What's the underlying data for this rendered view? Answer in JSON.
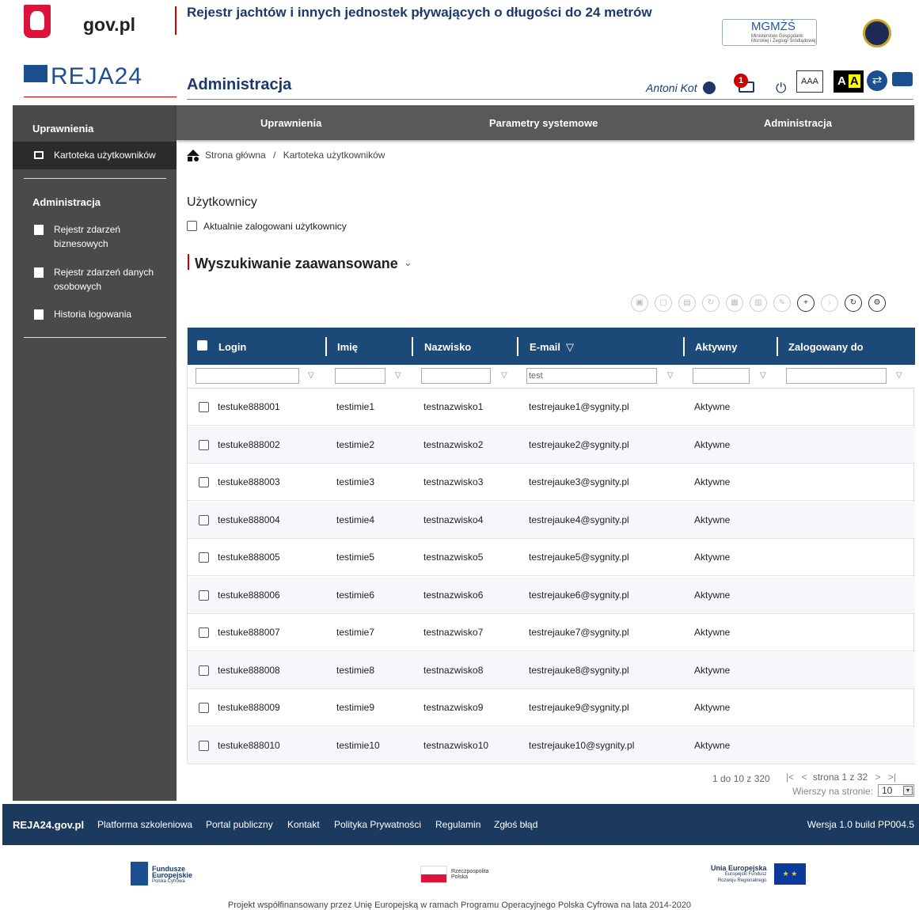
{
  "header": {
    "gov": "gov.pl",
    "registry_title": "Rejestr jachtów i innych jednostek pływających o długości do 24 metrów",
    "mgm_main": "MGMŻŚ",
    "mgm_sub": "Ministerstwo Gospodarki Morskiej i Żeglugi Śródlądowej",
    "app_logo": "REJA24",
    "page_title": "Administracja",
    "user_name": "Antoni Kot",
    "mail_badge": "1",
    "font_size_label": "AAA",
    "contrast_a1": "A",
    "contrast_a2": "A"
  },
  "sidebar": {
    "section1": "Uprawnienia",
    "item_users": "Kartoteka użytkowników",
    "section2": "Administracja",
    "item_business": "Rejestr zdarzeń biznesowych",
    "item_personal": "Rejestr zdarzeń danych osobowych",
    "item_login": "Historia logowania"
  },
  "topnav": {
    "tab1": "Uprawnienia",
    "tab2": "Parametry systemowe",
    "tab3": "Administracja"
  },
  "breadcrumb": {
    "home": "Strona główna",
    "sep": "/",
    "current": "Kartoteka użytkowników"
  },
  "main": {
    "heading": "Użytkownicy",
    "logged_checkbox": "Aktualnie zalogowani użytkownicy",
    "advanced": "Wyszukiwanie zaawansowane"
  },
  "grid": {
    "columns": [
      "Login",
      "Imię",
      "Nazwisko",
      "E-mail",
      "Aktywny",
      "Zalogowany do"
    ],
    "filter_email": "test",
    "rows": [
      [
        "testuke888001",
        "testimie1",
        "testnazwisko1",
        "testrejauke1@sygnity.pl",
        "Aktywne"
      ],
      [
        "testuke888002",
        "testimie2",
        "testnazwisko2",
        "testrejauke2@sygnity.pl",
        "Aktywne"
      ],
      [
        "testuke888003",
        "testimie3",
        "testnazwisko3",
        "testrejauke3@sygnity.pl",
        "Aktywne"
      ],
      [
        "testuke888004",
        "testimie4",
        "testnazwisko4",
        "testrejauke4@sygnity.pl",
        "Aktywne"
      ],
      [
        "testuke888005",
        "testimie5",
        "testnazwisko5",
        "testrejauke5@sygnity.pl",
        "Aktywne"
      ],
      [
        "testuke888006",
        "testimie6",
        "testnazwisko6",
        "testrejauke6@sygnity.pl",
        "Aktywne"
      ],
      [
        "testuke888007",
        "testimie7",
        "testnazwisko7",
        "testrejauke7@sygnity.pl",
        "Aktywne"
      ],
      [
        "testuke888008",
        "testimie8",
        "testnazwisko8",
        "testrejauke8@sygnity.pl",
        "Aktywne"
      ],
      [
        "testuke888009",
        "testimie9",
        "testnazwisko9",
        "testrejauke9@sygnity.pl",
        "Aktywne"
      ],
      [
        "testuke888010",
        "testimie10",
        "testnazwisko10",
        "testrejauke10@sygnity.pl",
        "Aktywne"
      ]
    ]
  },
  "pager": {
    "range": "1 do 10 z 320",
    "page": "strona 1 z 32",
    "per_page_label": "Wierszy na stronie:",
    "per_page": "10"
  },
  "footer": {
    "site": "REJA24.gov.pl",
    "l1": "Platforma szkoleniowa",
    "l2": "Portal publiczny",
    "l3": "Kontakt",
    "l4": "Polityka Prywatności",
    "l5": "Regulamin",
    "l6": "Zgłoś błąd",
    "version": "Wersja 1.0 build PP004.5"
  },
  "logos": {
    "fe1": "Fundusze",
    "fe2": "Europejskie",
    "fe3": "Polska Cyfrowa",
    "pl1": "Rzeczpospolita",
    "pl2": "Polska",
    "ue1": "Unia Europejska",
    "ue2": "Europejski Fundusz",
    "ue3": "Rozwoju Regionalnego"
  },
  "project_note": "Projekt współfinansowany przez Unię Europejską w ramach Programu Operacyjnego Polska Cyfrowa na lata 2014-2020",
  "colors": {
    "navy": "#1b3a6b",
    "grid_header": "#1b4a78",
    "sidebar": "#4a4a4a",
    "footer": "#1b3a5e",
    "accent_red": "#c00"
  }
}
